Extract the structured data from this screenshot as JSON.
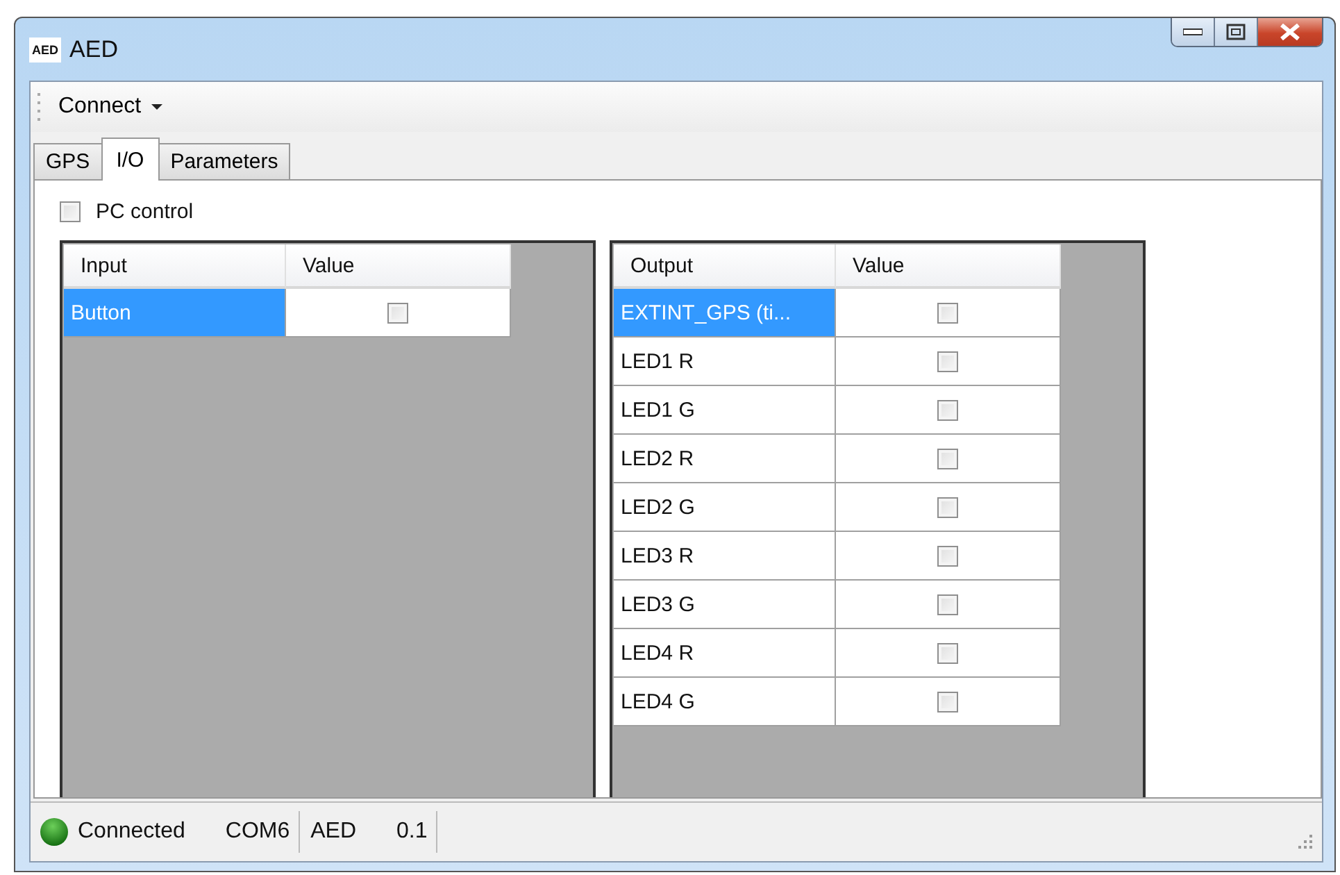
{
  "window": {
    "icon_text": "AED",
    "title": "AED"
  },
  "toolbar": {
    "menu": "Connect"
  },
  "tabs": [
    {
      "label": "GPS",
      "selected": false
    },
    {
      "label": "I/O",
      "selected": true
    },
    {
      "label": "Parameters",
      "selected": false
    }
  ],
  "pc_control": {
    "label": "PC control",
    "checked": false
  },
  "grids": [
    {
      "columns": [
        "Input",
        "Value"
      ],
      "rows": [
        {
          "name": "Button",
          "checked": false,
          "selected": true
        }
      ]
    },
    {
      "columns": [
        "Output",
        "Value"
      ],
      "rows": [
        {
          "name": "EXTINT_GPS (ti...",
          "checked": false,
          "selected": true
        },
        {
          "name": "LED1 R",
          "checked": false,
          "selected": false
        },
        {
          "name": "LED1 G",
          "checked": false,
          "selected": false
        },
        {
          "name": "LED2 R",
          "checked": false,
          "selected": false
        },
        {
          "name": "LED2 G",
          "checked": false,
          "selected": false
        },
        {
          "name": "LED3 R",
          "checked": false,
          "selected": false
        },
        {
          "name": "LED3 G",
          "checked": false,
          "selected": false
        },
        {
          "name": "LED4 R",
          "checked": false,
          "selected": false
        },
        {
          "name": "LED4 G",
          "checked": false,
          "selected": false
        }
      ]
    }
  ],
  "status_bar": {
    "status": "Connected",
    "port": "COM6",
    "device": "AED",
    "version": "0.1"
  }
}
